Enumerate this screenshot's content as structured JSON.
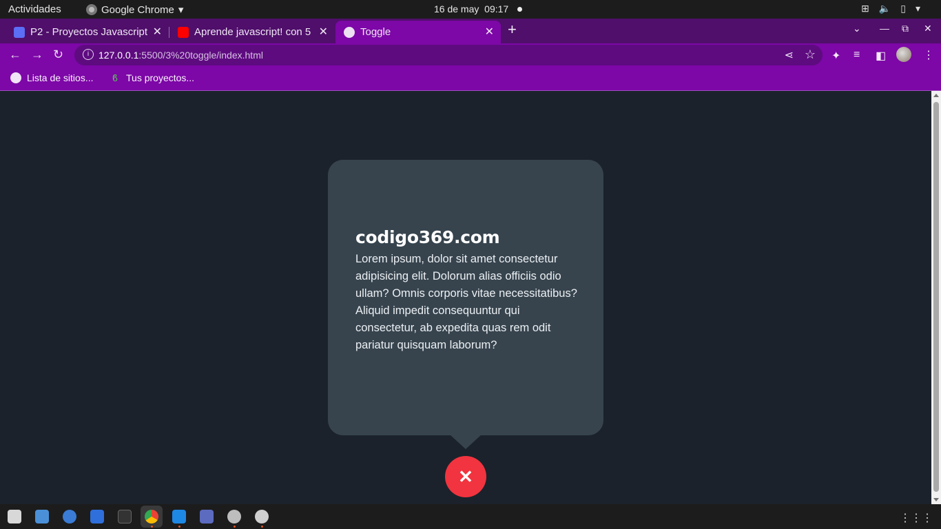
{
  "topbar": {
    "activities": "Actividades",
    "app_name": "Google Chrome",
    "date": "16 de may",
    "time": "09:17"
  },
  "tabs": [
    {
      "title": "P2 - Proyectos Javascript",
      "favicon": "classroom-icon",
      "active": false
    },
    {
      "title": "Aprende javascript! con 5",
      "favicon": "youtube-icon",
      "active": false
    },
    {
      "title": "Toggle",
      "favicon": "globe-icon",
      "active": true
    }
  ],
  "omnibox": {
    "host": "127.0.0.1",
    "path": ":5500/3%20toggle/index.html"
  },
  "bookmarks": [
    {
      "label": "Lista de sitios...",
      "icon": "globe-icon"
    },
    {
      "label": "Tus proyectos...",
      "icon": "leaf-icon"
    }
  ],
  "card": {
    "heading": "codigo369.com",
    "body": "Lorem ipsum, dolor sit amet consectetur adipisicing elit. Dolorum alias officiis odio ullam? Omnis corporis vitae necessitatibus? Aliquid impedit consequuntur qui consectetur, ab expedita quas rem odit pariatur quisquam laborum?"
  },
  "close_button": {
    "icon": "close-icon",
    "glyph": "✕"
  },
  "colors": {
    "tab_active": "#7d07a7",
    "tabstrip": "#4f0f6a",
    "page_bg": "#1b222b",
    "card_bg": "#37444e",
    "close_btn": "#f1343f"
  }
}
